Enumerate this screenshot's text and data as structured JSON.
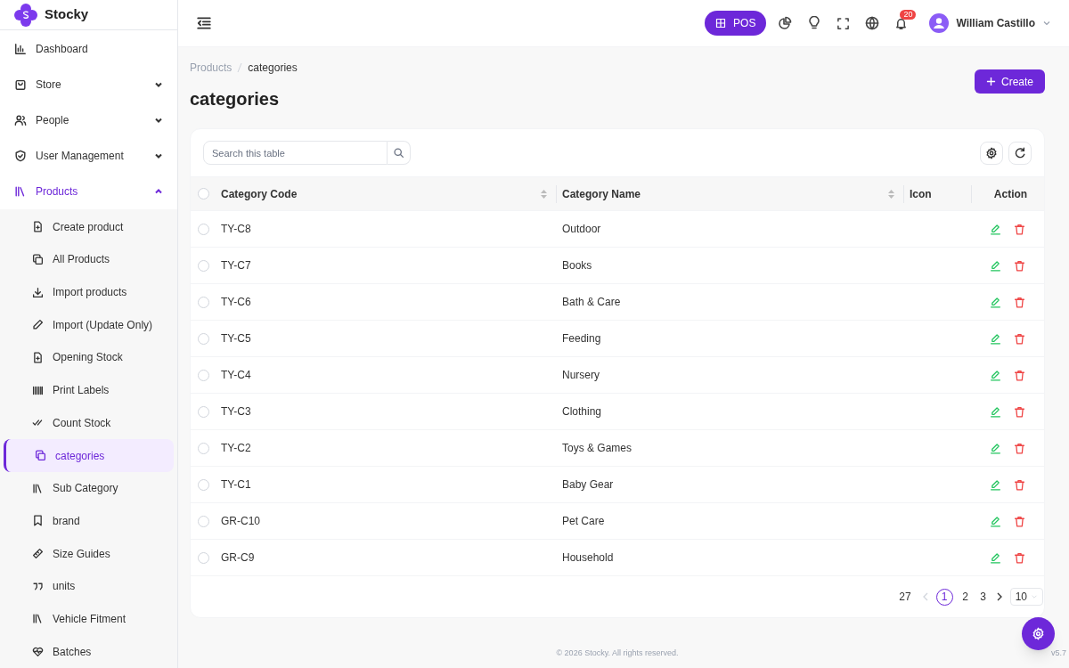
{
  "app": {
    "name": "Stocky"
  },
  "sidebar": {
    "items": [
      {
        "label": "Dashboard",
        "selected": false
      },
      {
        "label": "Store",
        "selected": false,
        "expanded": false
      },
      {
        "label": "People",
        "selected": false,
        "expanded": false
      },
      {
        "label": "User Management",
        "selected": false,
        "expanded": false
      },
      {
        "label": "Products",
        "selected": true,
        "expanded": true,
        "children": [
          {
            "label": "Create product",
            "selected": false
          },
          {
            "label": "All Products",
            "selected": false
          },
          {
            "label": "Import products",
            "selected": false
          },
          {
            "label": "Import (Update Only)",
            "selected": false
          },
          {
            "label": "Opening Stock",
            "selected": false
          },
          {
            "label": "Print Labels",
            "selected": false
          },
          {
            "label": "Count Stock",
            "selected": false
          },
          {
            "label": "categories",
            "selected": true
          },
          {
            "label": "Sub Category",
            "selected": false
          },
          {
            "label": "brand",
            "selected": false
          },
          {
            "label": "Size Guides",
            "selected": false
          },
          {
            "label": "units",
            "selected": false
          },
          {
            "label": "Vehicle Fitment",
            "selected": false
          },
          {
            "label": "Batches",
            "selected": false
          }
        ]
      }
    ]
  },
  "header": {
    "pos_button": "POS",
    "notifications": "20",
    "user": "William Castillo"
  },
  "breadcrumb": [
    "Products",
    "categories"
  ],
  "page_title": "categories",
  "create_button": "Create",
  "table": {
    "search": {
      "placeholder": "Search this table"
    },
    "select_all_checked": false,
    "columns": [
      "Category Code",
      "Category Name",
      "Icon",
      "Action"
    ],
    "rows": [
      {
        "code": "TY-C8",
        "name": "Outdoor",
        "checked": false
      },
      {
        "code": "TY-C7",
        "name": "Books",
        "checked": false
      },
      {
        "code": "TY-C6",
        "name": "Bath & Care",
        "checked": false
      },
      {
        "code": "TY-C5",
        "name": "Feeding",
        "checked": false
      },
      {
        "code": "TY-C4",
        "name": "Nursery",
        "checked": false
      },
      {
        "code": "TY-C3",
        "name": "Clothing",
        "checked": false
      },
      {
        "code": "TY-C2",
        "name": "Toys & Games",
        "checked": false
      },
      {
        "code": "TY-C1",
        "name": "Baby Gear",
        "checked": false
      },
      {
        "code": "GR-C10",
        "name": "Pet Care",
        "checked": false
      },
      {
        "code": "GR-C9",
        "name": "Household",
        "checked": false
      }
    ]
  },
  "pagination": {
    "total": "27",
    "pages": [
      {
        "label": "1",
        "selected": true
      },
      {
        "label": "2",
        "selected": false
      },
      {
        "label": "3",
        "selected": false
      }
    ],
    "page_size": "10"
  },
  "footer": {
    "copyright": "© 2026 Stocky. All rights reserved.",
    "version": "v5.7"
  }
}
